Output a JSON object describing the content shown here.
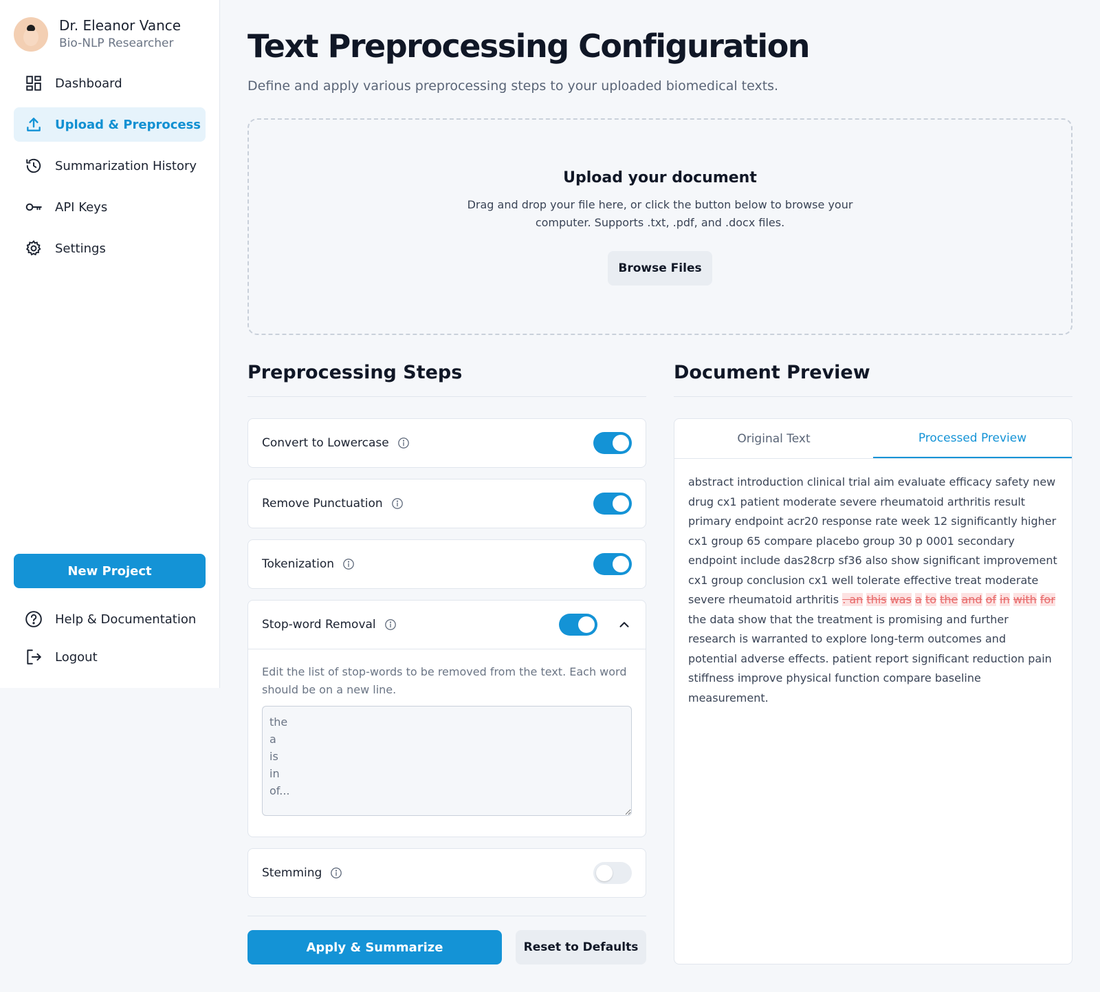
{
  "user": {
    "name": "Dr. Eleanor Vance",
    "role": "Bio-NLP Researcher"
  },
  "nav": {
    "items": [
      {
        "label": "Dashboard",
        "icon": "dashboard-icon"
      },
      {
        "label": "Upload & Preprocess",
        "icon": "upload-icon",
        "active": true
      },
      {
        "label": "Summarization History",
        "icon": "history-icon"
      },
      {
        "label": "API Keys",
        "icon": "key-icon"
      },
      {
        "label": "Settings",
        "icon": "gear-icon"
      }
    ],
    "new_project": "New Project",
    "bottom": [
      {
        "label": "Help & Documentation",
        "icon": "help-icon"
      },
      {
        "label": "Logout",
        "icon": "logout-icon"
      }
    ]
  },
  "page": {
    "title": "Text Preprocessing Configuration",
    "subtitle": "Define and apply various preprocessing steps to your uploaded biomedical texts."
  },
  "upload": {
    "title": "Upload your document",
    "description": "Drag and drop your file here, or click the button below to browse your computer. Supports .txt, .pdf, and .docx files.",
    "button": "Browse Files"
  },
  "steps": {
    "title": "Preprocessing Steps",
    "items": [
      {
        "label": "Convert to Lowercase",
        "enabled": true
      },
      {
        "label": "Remove Punctuation",
        "enabled": true
      },
      {
        "label": "Tokenization",
        "enabled": true
      },
      {
        "label": "Stop-word Removal",
        "enabled": true,
        "expanded": true
      },
      {
        "label": "Stemming",
        "enabled": false
      }
    ],
    "stopword_description": "Edit the list of stop-words to be removed from the text. Each word should be on a new line.",
    "stopword_list": "the\na\nis\nin\nof...",
    "apply_button": "Apply & Summarize",
    "reset_button": "Reset to Defaults"
  },
  "preview": {
    "title": "Document Preview",
    "tabs": [
      {
        "label": "Original Text",
        "active": false
      },
      {
        "label": "Processed Preview",
        "active": true
      }
    ],
    "text_before": "abstract introduction clinical trial aim evaluate efficacy safety new drug cx1 patient moderate severe rheumatoid arthritis result primary endpoint acr20 response rate week 12 significantly higher cx1 group 65 compare placebo group 30 p 0001 secondary endpoint include das28crp sf36 also show significant improvement cx1 group conclusion cx1 well tolerate effective treat moderate severe rheumatoid arthritis",
    "removed_words": [
      ". an",
      "this",
      "was",
      "a",
      "to",
      "the",
      "and",
      "of",
      "in",
      "with",
      "for"
    ],
    "text_after": "the data show that the treatment is promising and further research is warranted to explore long-term outcomes and potential adverse effects. patient report significant reduction pain stiffness improve physical function compare baseline measurement."
  },
  "colors": {
    "accent": "#1493d6",
    "accent_bg": "#e6f3fb",
    "removed_bg": "#fde2e2",
    "removed_text": "#e76a6a"
  }
}
